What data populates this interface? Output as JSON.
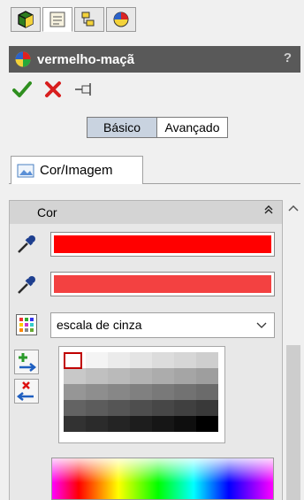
{
  "manager_tabs": [
    {
      "icon": "feature-manager-icon"
    },
    {
      "icon": "property-manager-icon"
    },
    {
      "icon": "configuration-manager-icon"
    },
    {
      "icon": "appearance-manager-icon"
    }
  ],
  "title": "vermelho-maçã",
  "help": "?",
  "actions": [
    "ok-check-icon",
    "cancel-x-icon",
    "pushpin-icon"
  ],
  "mode_toggle": {
    "basic": "Básico",
    "advanced": "Avançado",
    "selected": "Básico"
  },
  "tab": {
    "label": "Cor/Imagem"
  },
  "color_group": {
    "title": "Cor",
    "primary_color": "#ff0000",
    "secondary_color": "#f34141",
    "palette_select": {
      "value": "escala de cinza"
    }
  },
  "palette_swatches": [
    [
      "#ffffff",
      "#f4f4f4",
      "#ebebeb",
      "#e4e4e4",
      "#dcdcdc",
      "#d6d6d6",
      "#cecece"
    ],
    [
      "#c8c8c8",
      "#c0c0c0",
      "#bababa",
      "#b3b3b3",
      "#acacac",
      "#a5a5a5",
      "#9e9e9e"
    ],
    [
      "#969696",
      "#8e8e8e",
      "#878787",
      "#808080",
      "#797979",
      "#727272",
      "#6b6b6b"
    ],
    [
      "#636363",
      "#5c5c5c",
      "#555555",
      "#4e4e4e",
      "#474747",
      "#404040",
      "#393939"
    ],
    [
      "#323232",
      "#2b2b2b",
      "#242424",
      "#1d1d1d",
      "#161616",
      "#0e0e0e",
      "#000000"
    ]
  ]
}
